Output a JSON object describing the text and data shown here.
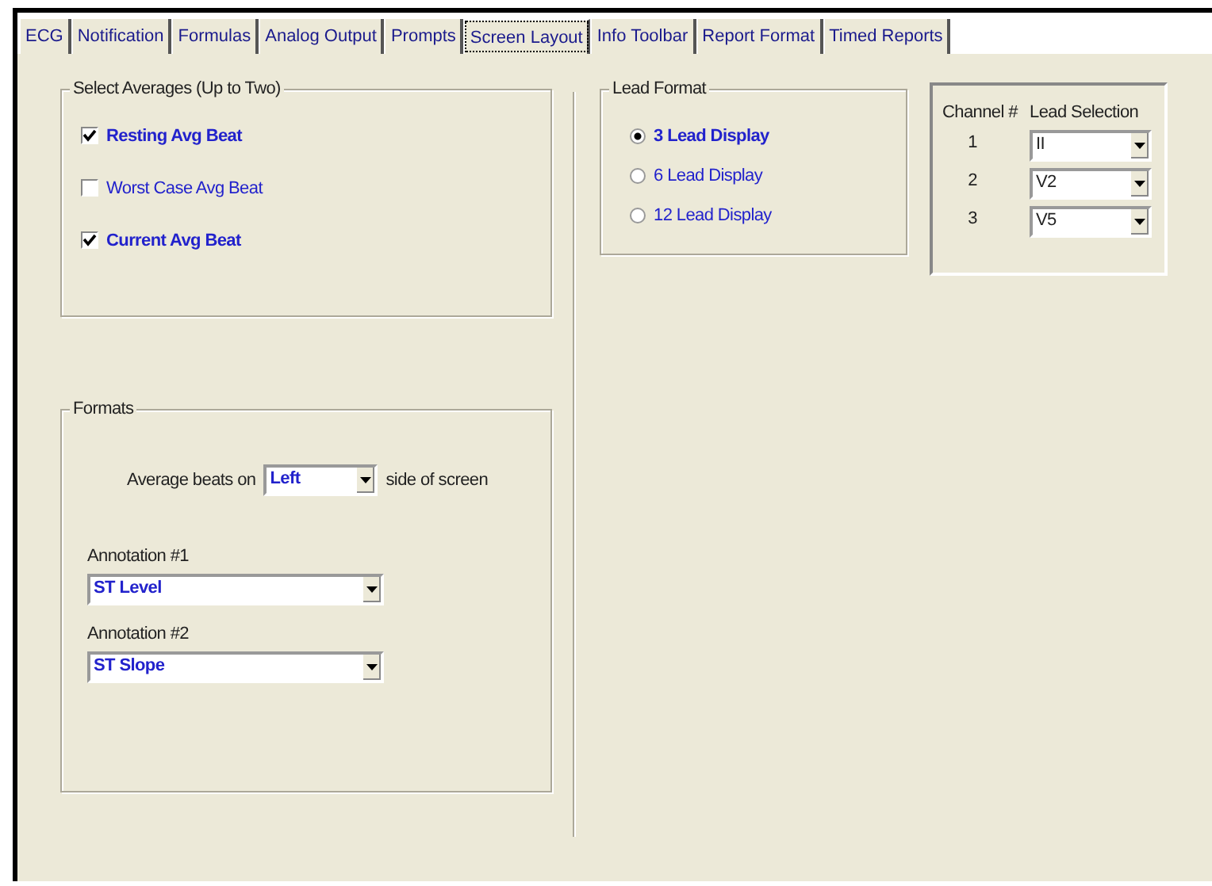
{
  "tabs": [
    {
      "label": "ECG",
      "selected": false
    },
    {
      "label": "Notification",
      "selected": false
    },
    {
      "label": "Formulas",
      "selected": false
    },
    {
      "label": "Analog Output",
      "selected": false
    },
    {
      "label": "Prompts",
      "selected": false
    },
    {
      "label": "Screen Layout",
      "selected": true
    },
    {
      "label": "Info Toolbar",
      "selected": false
    },
    {
      "label": "Report Format",
      "selected": false
    },
    {
      "label": "Timed Reports",
      "selected": false
    }
  ],
  "select_averages": {
    "title": "Select Averages (Up to Two)",
    "options": [
      {
        "label": "Resting Avg Beat",
        "checked": true
      },
      {
        "label": "Worst Case Avg Beat",
        "checked": false
      },
      {
        "label": "Current Avg Beat",
        "checked": true
      }
    ]
  },
  "formats": {
    "title": "Formats",
    "average_beats_label": "Average beats on",
    "average_beats_value": "Left",
    "average_beats_suffix": "side of screen",
    "annotations": [
      {
        "label": "Annotation #1",
        "value": "ST Level"
      },
      {
        "label": "Annotation #2",
        "value": "ST Slope"
      }
    ]
  },
  "lead_format": {
    "title": "Lead Format",
    "options": [
      {
        "label": "3 Lead Display",
        "selected": true
      },
      {
        "label": "6 Lead Display",
        "selected": false
      },
      {
        "label": "12 Lead Display",
        "selected": false
      }
    ]
  },
  "channels": {
    "columns": [
      "Channel #",
      "Lead Selection"
    ],
    "rows": [
      {
        "channel": "1",
        "lead": "II"
      },
      {
        "channel": "2",
        "lead": "V2"
      },
      {
        "channel": "3",
        "lead": "V5"
      }
    ]
  }
}
